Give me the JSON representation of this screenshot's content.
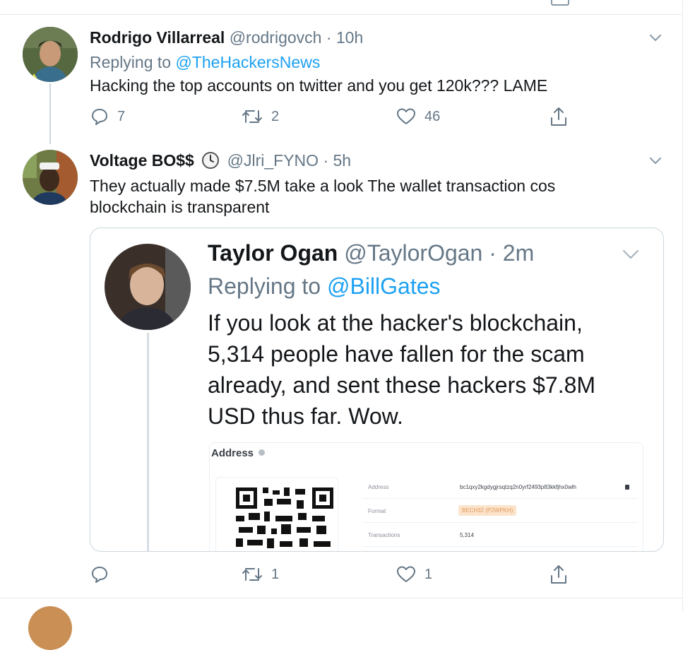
{
  "tweets": [
    {
      "name": "Rodrigo Villarreal",
      "handle": "@rodrigovch",
      "sep": "·",
      "time": "10h",
      "replying_prefix": "Replying to",
      "replying_to": "@TheHackersNews",
      "text": "Hacking the top accounts on twitter and you get 120k??? LAME",
      "replies": "7",
      "retweets": "2",
      "likes": "46"
    },
    {
      "name": "Voltage BO$$",
      "handle": "@Jlri_FYNO",
      "sep": "·",
      "time": "5h",
      "text": "They actually made $7.5M take a look The wallet transaction cos blockchain is transparent",
      "replies": "",
      "retweets": "1",
      "likes": "1"
    }
  ],
  "embedded_screenshot": {
    "name": "Taylor Ogan",
    "handle": "@TaylorOgan",
    "sep": "·",
    "time": "2m",
    "replying_prefix": "Replying to",
    "replying_to": "@BillGates",
    "lines": [
      "If you look at the hacker's blockchain,",
      "5,314 people have fallen for the scam",
      "already, and sent these hackers $7.8M",
      "USD thus far. Wow."
    ],
    "address_panel": {
      "title": "Address",
      "rows": [
        {
          "label": "Address",
          "value": "bc1qxy2kgdygjrsqtzq2n0yrf2493p83kkfjhx0wlh"
        },
        {
          "label": "Format",
          "value": "BECH32 (P2WPKH)"
        },
        {
          "label": "Transactions",
          "value": "5,314"
        }
      ]
    }
  },
  "colors": {
    "link": "#1da1f2",
    "muted": "#657786",
    "border": "#e6ecf0"
  }
}
